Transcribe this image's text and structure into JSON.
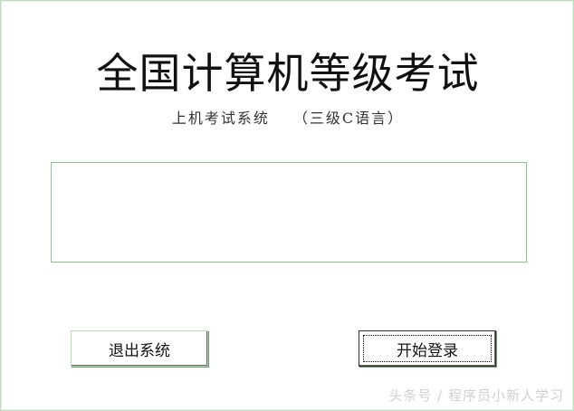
{
  "title": "全国计算机等级考试",
  "subtitle": {
    "system": "上机考试系统",
    "level": "（三级C语言）"
  },
  "buttons": {
    "exit_label": "退出系统",
    "login_label": "开始登录"
  },
  "watermark": "头条号 / 程序员小新人学习"
}
